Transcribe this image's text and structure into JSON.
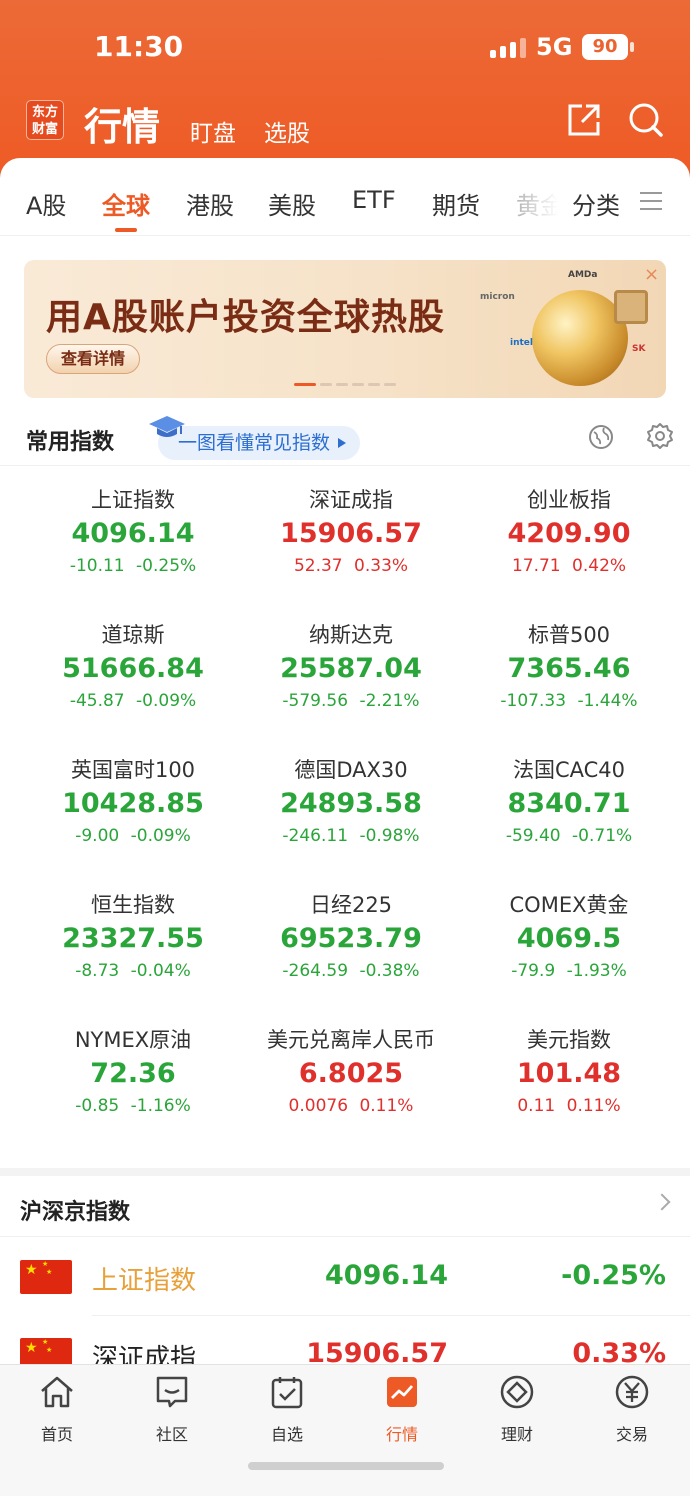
{
  "status": {
    "time": "11:30",
    "network": "5G",
    "battery": "90"
  },
  "header": {
    "logo": "东方财富",
    "logo_l1": "东方",
    "logo_l2": "财富",
    "title": "行情",
    "sub1": "盯盘",
    "sub2": "选股"
  },
  "tabs": [
    "A股",
    "全球",
    "港股",
    "美股",
    "ETF",
    "期货",
    "黄金",
    "分类"
  ],
  "banner": {
    "title": "用A股账户投资全球热股",
    "button": "查看详情",
    "close": "×",
    "chip_labels": [
      "AMDa",
      "micron",
      "intel",
      "SK"
    ]
  },
  "section": {
    "title": "常用指数",
    "guide": "一图看懂常见指数"
  },
  "indices": [
    {
      "name": "上证指数",
      "price": "4096.14",
      "change": "-10.11",
      "pct": "-0.25%",
      "dir": "down"
    },
    {
      "name": "深证成指",
      "price": "15906.57",
      "change": "52.37",
      "pct": "0.33%",
      "dir": "up"
    },
    {
      "name": "创业板指",
      "price": "4209.90",
      "change": "17.71",
      "pct": "0.42%",
      "dir": "up"
    },
    {
      "name": "道琼斯",
      "price": "51666.84",
      "change": "-45.87",
      "pct": "-0.09%",
      "dir": "down"
    },
    {
      "name": "纳斯达克",
      "price": "25587.04",
      "change": "-579.56",
      "pct": "-2.21%",
      "dir": "down"
    },
    {
      "name": "标普500",
      "price": "7365.46",
      "change": "-107.33",
      "pct": "-1.44%",
      "dir": "down"
    },
    {
      "name": "英国富时100",
      "price": "10428.85",
      "change": "-9.00",
      "pct": "-0.09%",
      "dir": "down"
    },
    {
      "name": "德国DAX30",
      "price": "24893.58",
      "change": "-246.11",
      "pct": "-0.98%",
      "dir": "down"
    },
    {
      "name": "法国CAC40",
      "price": "8340.71",
      "change": "-59.40",
      "pct": "-0.71%",
      "dir": "down"
    },
    {
      "name": "恒生指数",
      "price": "23327.55",
      "change": "-8.73",
      "pct": "-0.04%",
      "dir": "down"
    },
    {
      "name": "日经225",
      "price": "69523.79",
      "change": "-264.59",
      "pct": "-0.38%",
      "dir": "down"
    },
    {
      "name": "COMEX黄金",
      "price": "4069.5",
      "change": "-79.9",
      "pct": "-1.93%",
      "dir": "down"
    },
    {
      "name": "NYMEX原油",
      "price": "72.36",
      "change": "-0.85",
      "pct": "-1.16%",
      "dir": "down"
    },
    {
      "name": "美元兑离岸人民币",
      "price": "6.8025",
      "change": "0.0076",
      "pct": "0.11%",
      "dir": "up"
    },
    {
      "name": "美元指数",
      "price": "101.48",
      "change": "0.11",
      "pct": "0.11%",
      "dir": "up"
    }
  ],
  "section2": {
    "title": "沪深京指数",
    "rows": [
      {
        "name": "上证指数",
        "price": "4096.14",
        "pct": "-0.25%",
        "name_color": "#e8a13a",
        "dir": "down"
      },
      {
        "name": "深证成指",
        "price": "15906.57",
        "pct": "0.33%",
        "name_color": "#222222",
        "dir": "up"
      }
    ]
  },
  "nav": [
    {
      "label": "首页",
      "icon": "home-icon"
    },
    {
      "label": "社区",
      "icon": "community-icon"
    },
    {
      "label": "自选",
      "icon": "watchlist-icon"
    },
    {
      "label": "行情",
      "icon": "market-icon",
      "active": true
    },
    {
      "label": "理财",
      "icon": "wealth-icon"
    },
    {
      "label": "交易",
      "icon": "trade-icon"
    }
  ],
  "colors": {
    "accent": "#ee5a25",
    "up": "#e0302c",
    "down": "#2aa53a"
  }
}
